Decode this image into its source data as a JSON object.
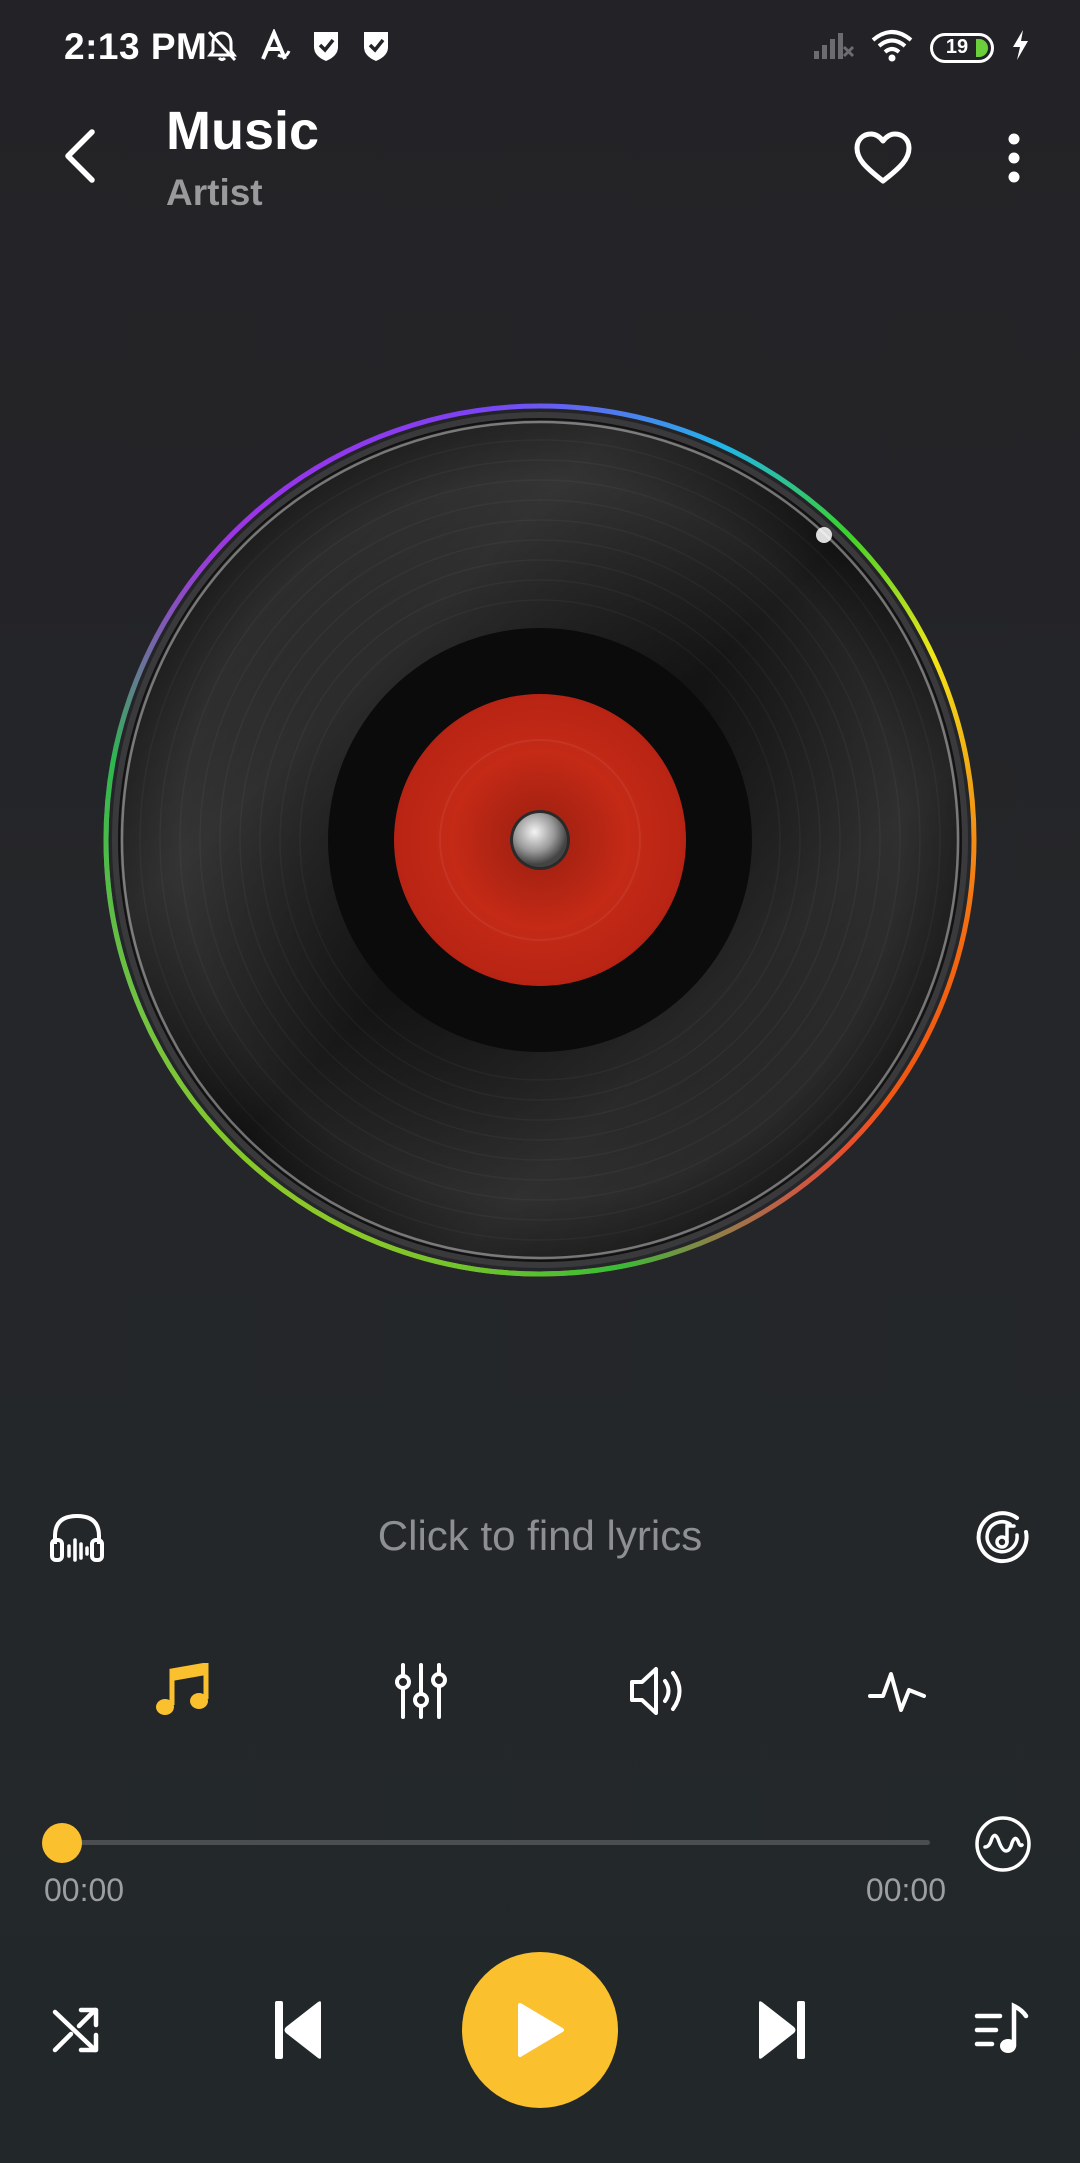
{
  "status_bar": {
    "time": "2:13 PM",
    "battery_level": "19",
    "icons": [
      "mute-icon",
      "a-icon",
      "shield-check-icon",
      "shield-check-icon",
      "signal-icon",
      "wifi-icon",
      "battery-icon",
      "charging-icon"
    ]
  },
  "header": {
    "title": "Music",
    "artist": "Artist",
    "icons": [
      "back-icon",
      "heart-icon",
      "more-vertical-icon"
    ]
  },
  "lyrics": {
    "prompt": "Click to find lyrics"
  },
  "tools": {
    "items": [
      "music-note-icon",
      "equalizer-icon",
      "volume-icon",
      "pulse-icon"
    ]
  },
  "progress": {
    "current_time": "00:00",
    "total_time": "00:00",
    "fraction": 0
  },
  "colors": {
    "accent": "#fbc02d",
    "background": "#232226",
    "label_red": "#c42a16"
  }
}
